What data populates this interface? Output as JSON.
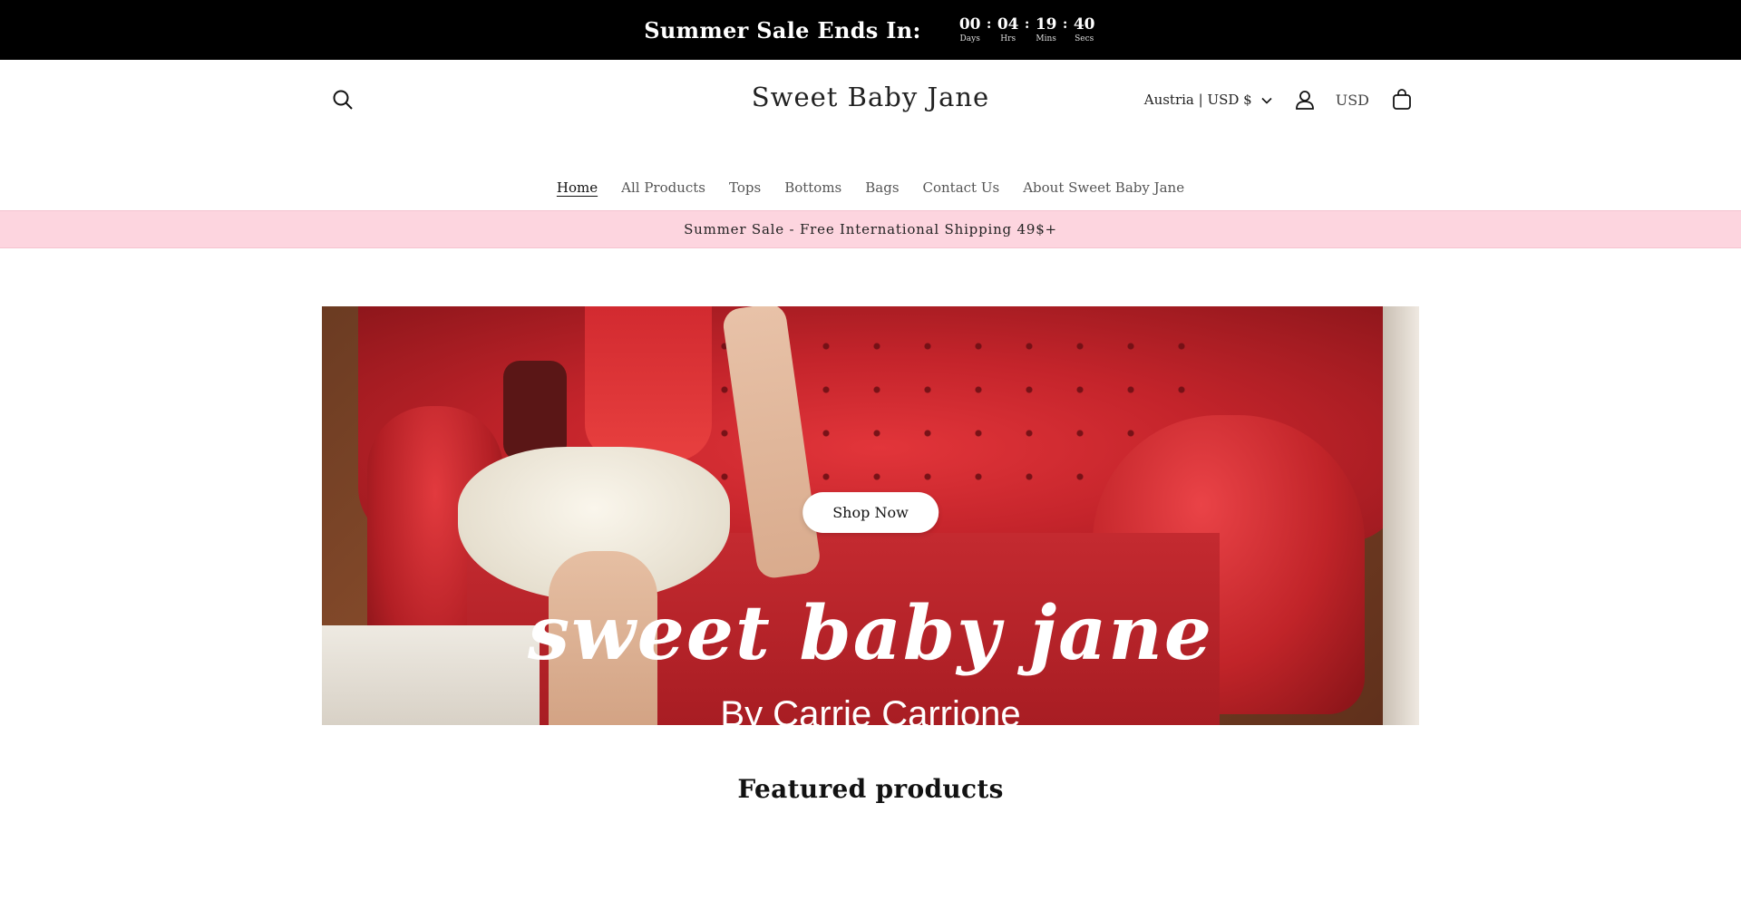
{
  "countdown": {
    "title": "Summer Sale Ends In:",
    "days": "00",
    "days_label": "Days",
    "hours": "04",
    "hours_label": "Hrs",
    "mins": "19",
    "mins_label": "Mins",
    "secs": "40",
    "secs_label": "Secs",
    "separator": ":"
  },
  "header": {
    "logo": "Sweet Baby Jane",
    "country_selector": "Austria | USD $",
    "currency": "USD",
    "icons": [
      "search-icon",
      "account-icon",
      "cart-icon",
      "chevron-down-icon"
    ]
  },
  "nav": {
    "items": [
      "Home",
      "All Products",
      "Tops",
      "Bottoms",
      "Bags",
      "Contact Us",
      "About Sweet Baby Jane"
    ],
    "active": "Home"
  },
  "announcement": {
    "text": "Summer Sale - Free International Shipping 49$+"
  },
  "hero": {
    "button_label": "Shop Now",
    "script_title": "sweet baby jane",
    "byline": "By Carrie Carrione"
  },
  "featured": {
    "heading": "Featured products"
  },
  "colors": {
    "countdown_bg": "#000000",
    "announcement_bg": "#fdd5df",
    "sofa_red": "#c4242b"
  }
}
